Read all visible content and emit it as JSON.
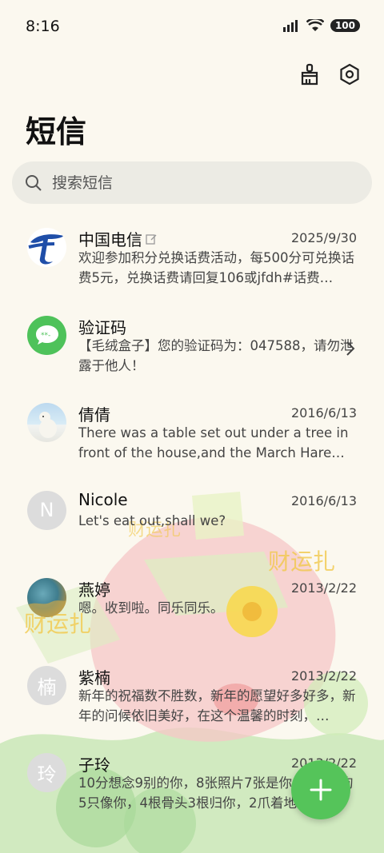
{
  "status_bar": {
    "time": "8:16",
    "battery": "100"
  },
  "header": {
    "title": "短信"
  },
  "search": {
    "placeholder": "搜索短信"
  },
  "conversations": [
    {
      "name": "中国电信",
      "date": "2025/9/30",
      "preview": "欢迎参加积分兑换话费活动，每500分可兑换话费5元，兑换话费请回复106或jfdh#话费…",
      "avatar": "china-telecom-logo"
    },
    {
      "name": "验证码",
      "date": "",
      "preview": "【毛绒盒子】您的验证码为：047588，请勿泄露于他人！",
      "avatar": "message-icon"
    },
    {
      "name": "倩倩",
      "date": "2016/6/13",
      "preview": "There was a table set out under a tree in front of the house,and the March Hare an…",
      "avatar": "polar-bear-photo"
    },
    {
      "name": "Nicole",
      "date": "2016/6/13",
      "preview": "Let's eat out,shall we?",
      "avatar_letter": "N"
    },
    {
      "name": "燕婷",
      "date": "2013/2/22",
      "preview": "嗯。收到啦。同乐同乐。",
      "avatar": "landscape-photo"
    },
    {
      "name": "紫楠",
      "date": "2013/2/22",
      "preview": "新年的祝福数不胜数，新年的愿望好多好多，新年的问候依旧美好，在这个温馨的时刻，…",
      "avatar_letter": "楠"
    },
    {
      "name": "子玲",
      "date": "2013/2/22",
      "preview": "10分想念9别的你，8张照片7张是你，6只小狗5只像你，4根骨头3根归你，2爪着地1定…",
      "avatar_letter": "玲"
    }
  ],
  "colors": {
    "accent": "#55c45a",
    "background": "#fbf8ef",
    "telecom_blue": "#1f4ea8"
  }
}
